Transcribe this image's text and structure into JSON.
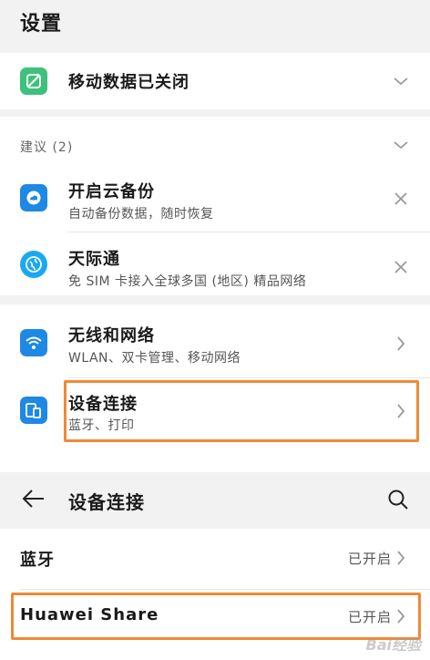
{
  "screen1": {
    "title": "设置",
    "mobile_data": {
      "label": "移动数据已关闭"
    },
    "suggestions": {
      "header": "建议 (2)",
      "items": [
        {
          "title": "开启云备份",
          "subtitle": "自动备份数据，随时恢复",
          "icon": "cloud-icon"
        },
        {
          "title": "天际通",
          "subtitle": "免 SIM 卡接入全球多国 (地区) 精品网络",
          "icon": "globe-icon"
        }
      ]
    },
    "settings": [
      {
        "title": "无线和网络",
        "subtitle": "WLAN、双卡管理、移动网络",
        "icon": "wifi-icon"
      },
      {
        "title": "设备连接",
        "subtitle": "蓝牙、打印",
        "icon": "device-connection-icon"
      }
    ]
  },
  "screen2": {
    "title": "设备连接",
    "items": [
      {
        "label": "蓝牙",
        "status": "已开启"
      },
      {
        "label": "Huawei Share",
        "status": "已开启"
      }
    ]
  },
  "watermark": "Bai经验",
  "colors": {
    "highlight": "#ef8a35",
    "green": "#3cc27a",
    "blue": "#1e88e5",
    "background": "#f2f2f2"
  }
}
